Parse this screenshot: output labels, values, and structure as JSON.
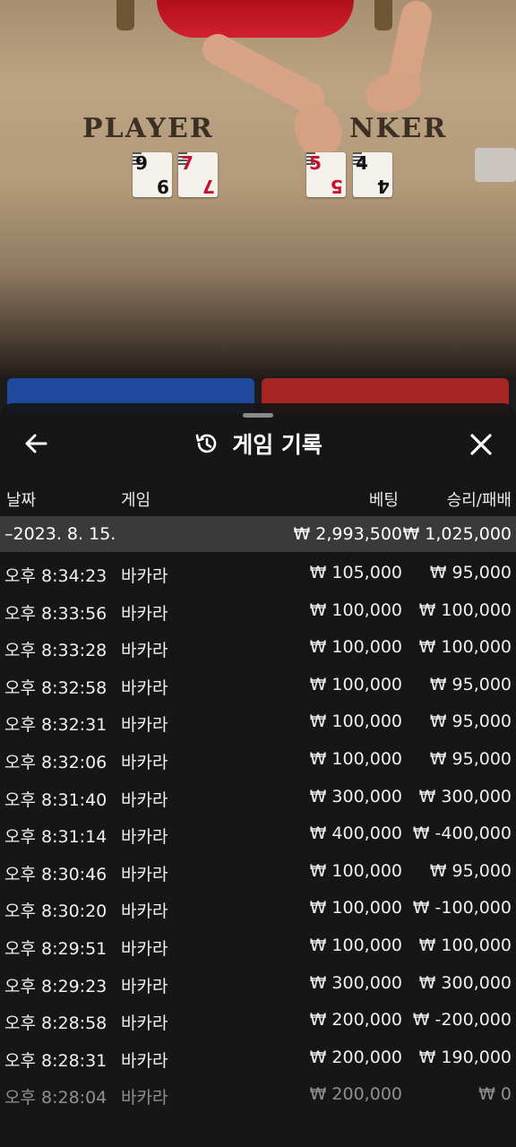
{
  "video": {
    "player_label": "PLAYER",
    "banker_label": "NKER",
    "player_cards": [
      {
        "rank": "9",
        "suit": "♠",
        "color": "black"
      },
      {
        "rank": "7",
        "suit": "♥",
        "color": "red"
      }
    ],
    "banker_cards": [
      {
        "rank": "5",
        "suit": "♥",
        "color": "red"
      },
      {
        "rank": "4",
        "suit": "♠",
        "color": "black"
      }
    ]
  },
  "sheet": {
    "title": "게임 기록",
    "title_icon": "history-icon",
    "back_icon": "arrow-left-icon",
    "close_icon": "close-icon"
  },
  "columns": {
    "date": "날짜",
    "game": "게임",
    "bet": "베팅",
    "result": "승리/패배"
  },
  "summary": {
    "date": "–2023. 8. 15.",
    "bet": "₩ 2,993,500",
    "result": "₩ 1,025,000"
  },
  "rows": [
    {
      "time": "오후 8:34:23",
      "game": "바카라",
      "bet": "₩ 105,000",
      "result": "₩ 95,000"
    },
    {
      "time": "오후 8:33:56",
      "game": "바카라",
      "bet": "₩ 100,000",
      "result": "₩ 100,000"
    },
    {
      "time": "오후 8:33:28",
      "game": "바카라",
      "bet": "₩ 100,000",
      "result": "₩ 100,000"
    },
    {
      "time": "오후 8:32:58",
      "game": "바카라",
      "bet": "₩ 100,000",
      "result": "₩ 95,000"
    },
    {
      "time": "오후 8:32:31",
      "game": "바카라",
      "bet": "₩ 100,000",
      "result": "₩ 95,000"
    },
    {
      "time": "오후 8:32:06",
      "game": "바카라",
      "bet": "₩ 100,000",
      "result": "₩ 95,000"
    },
    {
      "time": "오후 8:31:40",
      "game": "바카라",
      "bet": "₩ 300,000",
      "result": "₩ 300,000"
    },
    {
      "time": "오후 8:31:14",
      "game": "바카라",
      "bet": "₩ 400,000",
      "result": "₩ -400,000"
    },
    {
      "time": "오후 8:30:46",
      "game": "바카라",
      "bet": "₩ 100,000",
      "result": "₩ 95,000"
    },
    {
      "time": "오후 8:30:20",
      "game": "바카라",
      "bet": "₩ 100,000",
      "result": "₩ -100,000"
    },
    {
      "time": "오후 8:29:51",
      "game": "바카라",
      "bet": "₩ 100,000",
      "result": "₩ 100,000"
    },
    {
      "time": "오후 8:29:23",
      "game": "바카라",
      "bet": "₩ 300,000",
      "result": "₩ 300,000"
    },
    {
      "time": "오후 8:28:58",
      "game": "바카라",
      "bet": "₩ 200,000",
      "result": "₩ -200,000"
    },
    {
      "time": "오후 8:28:31",
      "game": "바카라",
      "bet": "₩ 200,000",
      "result": "₩ 190,000"
    },
    {
      "time": "오후 8:28:04",
      "game": "바카라",
      "bet": "₩ 200,000",
      "result": "₩ 0"
    }
  ]
}
